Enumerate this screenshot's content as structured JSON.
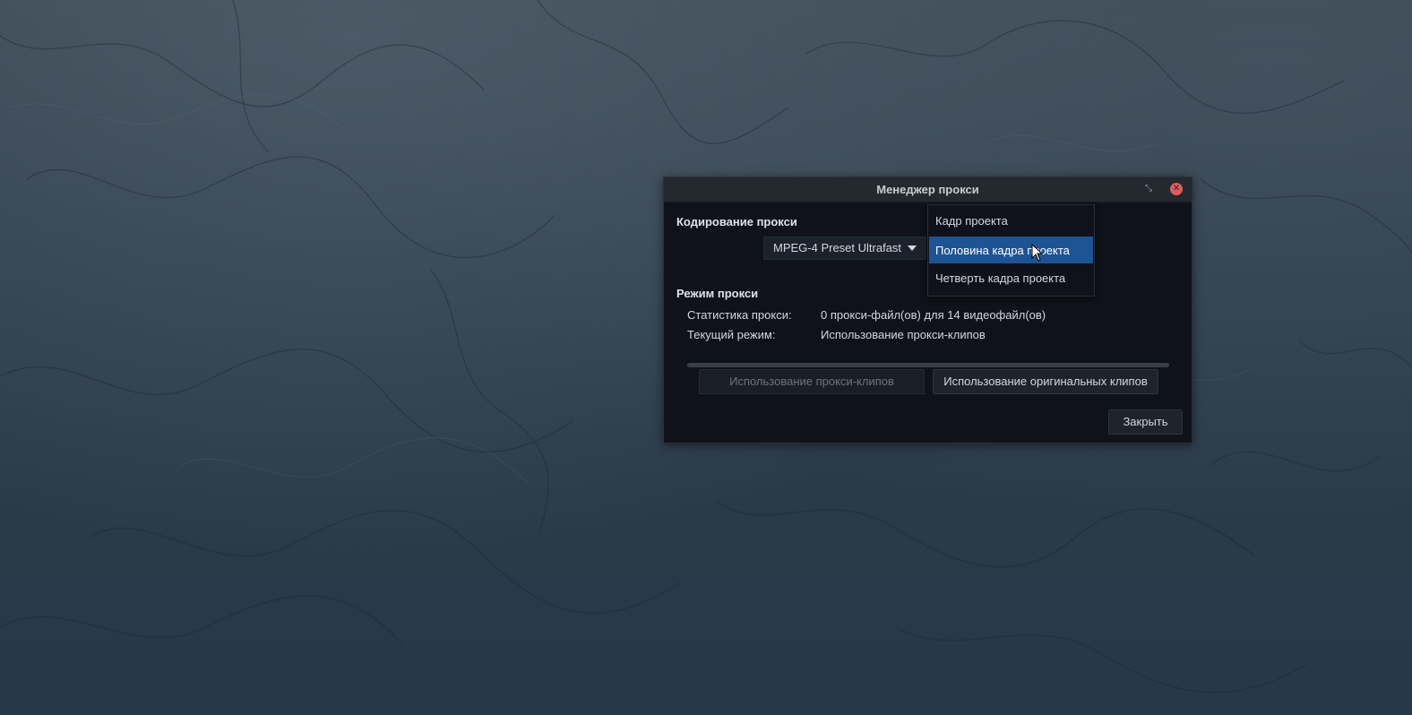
{
  "dialog": {
    "title": "Менеджер прокси",
    "restore_icon": "restore-icon",
    "close_icon": "close-icon",
    "encoding_section": {
      "title": "Кодирование прокси",
      "preset_value": "MPEG-4 Preset Ultrafast"
    },
    "resolution_dropdown": {
      "options": [
        "Кадр проекта",
        "Половина кадра проекта",
        "Четверть кадра проекта"
      ],
      "selected_index": 1
    },
    "mode_section": {
      "title": "Режим прокси",
      "stats_label": "Статистика прокси:",
      "stats_value": "0 прокси-файл(ов) для 14 видеофайл(ов)",
      "current_label": "Текущий режим:",
      "current_value": "Использование прокси-клипов",
      "progress": 0
    },
    "buttons": {
      "use_proxy": "Использование прокси-клипов",
      "use_original": "Использование оригинальных клипов",
      "close": "Закрыть"
    }
  },
  "colors": {
    "selection": "#1e5494",
    "close_button": "#e05c5c",
    "dialog_bg": "#0f121a"
  }
}
